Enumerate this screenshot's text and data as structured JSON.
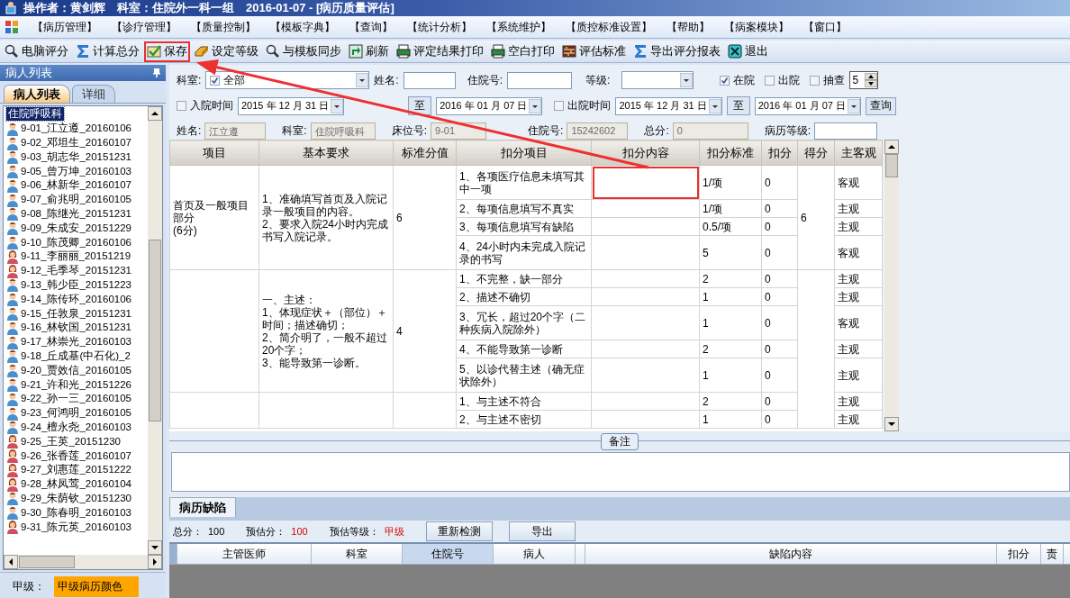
{
  "window": {
    "title": "操作者：黄剑辉　科室：住院外一科一组　2016-01-07 - [病历质量评估]"
  },
  "menu": [
    "【病历管理】",
    "【诊疗管理】",
    "【质量控制】",
    "【模板字典】",
    "【查询】",
    "【统计分析】",
    "【系统维护】",
    "【质控标准设置】",
    "【帮助】",
    "【病案模块】",
    "【窗口】"
  ],
  "toolbar": [
    {
      "label": "电脑评分",
      "highlighted": false
    },
    {
      "label": "计算总分",
      "highlighted": false
    },
    {
      "label": "保存",
      "highlighted": true
    },
    {
      "label": "设定等级",
      "highlighted": false
    },
    {
      "label": "与模板同步",
      "highlighted": false
    },
    {
      "label": "刷新",
      "highlighted": false
    },
    {
      "label": "评定结果打印",
      "highlighted": false
    },
    {
      "label": "空白打印",
      "highlighted": false
    },
    {
      "label": "评估标准",
      "highlighted": false
    },
    {
      "label": "导出评分报表",
      "highlighted": false
    },
    {
      "label": "退出",
      "highlighted": false
    }
  ],
  "sidebar": {
    "title": "病人列表",
    "tabs": [
      {
        "label": "病人列表",
        "selected": true
      },
      {
        "label": "详细",
        "selected": false
      }
    ],
    "tree": {
      "label": "住院呼吸科",
      "selected": true,
      "children": [
        {
          "label": "9-01_江立遵_20160106",
          "kind": "male"
        },
        {
          "label": "9-02_邓坦生_20160107",
          "kind": "male"
        },
        {
          "label": "9-03_胡志华_20151231",
          "kind": "male"
        },
        {
          "label": "9-05_曾万坤_20160103",
          "kind": "male"
        },
        {
          "label": "9-06_林新华_20160107",
          "kind": "male"
        },
        {
          "label": "9-07_俞兆明_20160105",
          "kind": "male"
        },
        {
          "label": "9-08_陈继光_20151231",
          "kind": "male"
        },
        {
          "label": "9-09_朱成安_20151229",
          "kind": "male"
        },
        {
          "label": "9-10_陈茂卿_20160106",
          "kind": "male"
        },
        {
          "label": "9-11_李丽丽_20151219",
          "kind": "female"
        },
        {
          "label": "9-12_毛季琴_20151231",
          "kind": "female"
        },
        {
          "label": "9-13_韩少臣_20151223",
          "kind": "male"
        },
        {
          "label": "9-14_陈传环_20160106",
          "kind": "male"
        },
        {
          "label": "9-15_任敦泉_20151231",
          "kind": "male"
        },
        {
          "label": "9-16_林钦国_20151231",
          "kind": "male"
        },
        {
          "label": "9-17_林崇光_20160103",
          "kind": "male"
        },
        {
          "label": "9-18_丘成基(中石化)_2",
          "kind": "male"
        },
        {
          "label": "9-20_贾效信_20160105",
          "kind": "male"
        },
        {
          "label": "9-21_许和光_20151226",
          "kind": "male"
        },
        {
          "label": "9-22_孙一三_20160105",
          "kind": "male"
        },
        {
          "label": "9-23_何鸿明_20160105",
          "kind": "male"
        },
        {
          "label": "9-24_檀永尧_20160103",
          "kind": "male"
        },
        {
          "label": "9-25_王英_20151230",
          "kind": "female"
        },
        {
          "label": "9-26_张香莲_20160107",
          "kind": "female"
        },
        {
          "label": "9-27_刘惠莲_20151222",
          "kind": "female"
        },
        {
          "label": "9-28_林凤莺_20160104",
          "kind": "female"
        },
        {
          "label": "9-29_朱荫钦_20151230",
          "kind": "male"
        },
        {
          "label": "9-30_陈春明_20160103",
          "kind": "male"
        },
        {
          "label": "9-31_陈元英_20160103",
          "kind": "female"
        }
      ]
    },
    "legend": {
      "label": "甲级：",
      "swatch": "甲级病历颜色",
      "color": "#ffa500"
    }
  },
  "filters": {
    "dept_label": "科室:",
    "dept_checked": true,
    "dept_value": "全部",
    "name_label": "姓名:",
    "inpatient_label": "住院号:",
    "grade_label": "等级:",
    "flags": [
      {
        "label": "在院",
        "checked": true
      },
      {
        "label": "出院",
        "checked": false
      },
      {
        "label": "抽查",
        "checked": false
      }
    ],
    "sample_count": "5",
    "ranges": [
      {
        "label": "入院时间",
        "checked": false,
        "from": "2015 年 12 月 31 日",
        "to_label": "至",
        "to": "2016 年 01 月 07 日"
      },
      {
        "label": "出院时间",
        "checked": false,
        "from": "2015 年 12 月 31 日",
        "to_label": "至",
        "to": "2016 年 01 月 07 日"
      }
    ],
    "query_button": "查询"
  },
  "patient_info": [
    {
      "label": "姓名:",
      "value": "江立遵",
      "disabled": true
    },
    {
      "label": "科室:",
      "value": "住院呼吸科",
      "disabled": true
    },
    {
      "label": "床位号:",
      "value": "9-01",
      "disabled": true
    },
    {
      "label": "住院号:",
      "value": "15242602",
      "disabled": true
    },
    {
      "label": "总分:",
      "value": "0",
      "disabled": true
    },
    {
      "label": "病历等级:",
      "disabled": false
    }
  ],
  "table": {
    "columns": [
      "项目",
      "基本要求",
      "标准分值",
      "扣分项目",
      "扣分内容",
      "扣分标准",
      "扣分",
      "得分",
      "主客观"
    ],
    "groups": [
      {
        "item": "首页及一般项目部分\n(6分)",
        "requirement": "1、准确填写首页及入院记录一般项目的内容。\n2、要求入院24小时内完成书写入院记录。",
        "standard": "6",
        "score": "6",
        "rows": [
          {
            "deduction_item": "1、各项医疗信息未填写其中一项",
            "highlighted": true,
            "criterion": "1/项",
            "deduction": "0",
            "type": "客观"
          },
          {
            "deduction_item": "2、每项信息填写不真实",
            "highlighted": false,
            "criterion": "1/项",
            "deduction": "0",
            "type": "主观"
          },
          {
            "deduction_item": "3、每项信息填写有缺陷",
            "highlighted": false,
            "criterion": "0.5/项",
            "deduction": "0",
            "type": "主观"
          },
          {
            "deduction_item": "4、24小时内未完成入院记录的书写",
            "highlighted": false,
            "criterion": "5",
            "deduction": "0",
            "type": "客观"
          }
        ]
      },
      {
        "requirement": "一、主述：\n1、体现症状＋（部位）＋时间；描述确切；\n2、简介明了，一般不超过20个字；\n3、能导致第一诊断。",
        "standard": "4",
        "rows": [
          {
            "deduction_item": "1、不完整，缺一部分",
            "highlighted": false,
            "criterion": "2",
            "deduction": "0",
            "type": "主观"
          },
          {
            "deduction_item": "2、描述不确切",
            "highlighted": false,
            "criterion": "1",
            "deduction": "0",
            "type": "主观"
          },
          {
            "deduction_item": "3、冗长，超过20个字（二种疾病入院除外）",
            "highlighted": false,
            "criterion": "1",
            "deduction": "0",
            "type": "客观"
          },
          {
            "deduction_item": "4、不能导致第一诊断",
            "highlighted": false,
            "criterion": "2",
            "deduction": "0",
            "type": "主观"
          },
          {
            "deduction_item": "5、以诊代替主述（确无症状除外）",
            "highlighted": false,
            "criterion": "1",
            "deduction": "0",
            "type": "主观"
          }
        ]
      },
      {
        "rows": [
          {
            "deduction_item": "1、与主述不符合",
            "highlighted": false,
            "criterion": "2",
            "deduction": "0",
            "type": "主观"
          },
          {
            "deduction_item": "2、与主述不密切",
            "highlighted": false,
            "criterion": "1",
            "deduction": "0",
            "type": "主观"
          }
        ]
      }
    ]
  },
  "notes": {
    "legend": "备注"
  },
  "defects": {
    "tab": {
      "label": "病历缺陷",
      "selected": true
    },
    "stats": [
      {
        "label": "总分：",
        "value": "100",
        "alert": false
      },
      {
        "label": "预估分：",
        "value": "100",
        "alert": true
      },
      {
        "label": "预估等级：",
        "value": "甲级",
        "alert": true
      }
    ],
    "buttons": [
      "重新检测",
      "导出"
    ],
    "columns": [
      {
        "label": "主管医师",
        "selected": false
      },
      {
        "label": "科室",
        "selected": false
      },
      {
        "label": "住院号",
        "selected": true
      },
      {
        "label": "病人",
        "selected": false
      },
      {
        "label": "缺陷内容",
        "selected": false
      },
      {
        "label": "扣分",
        "selected": false
      },
      {
        "label": "责",
        "selected": false
      }
    ]
  },
  "annotation": {
    "kind": "arrow"
  }
}
